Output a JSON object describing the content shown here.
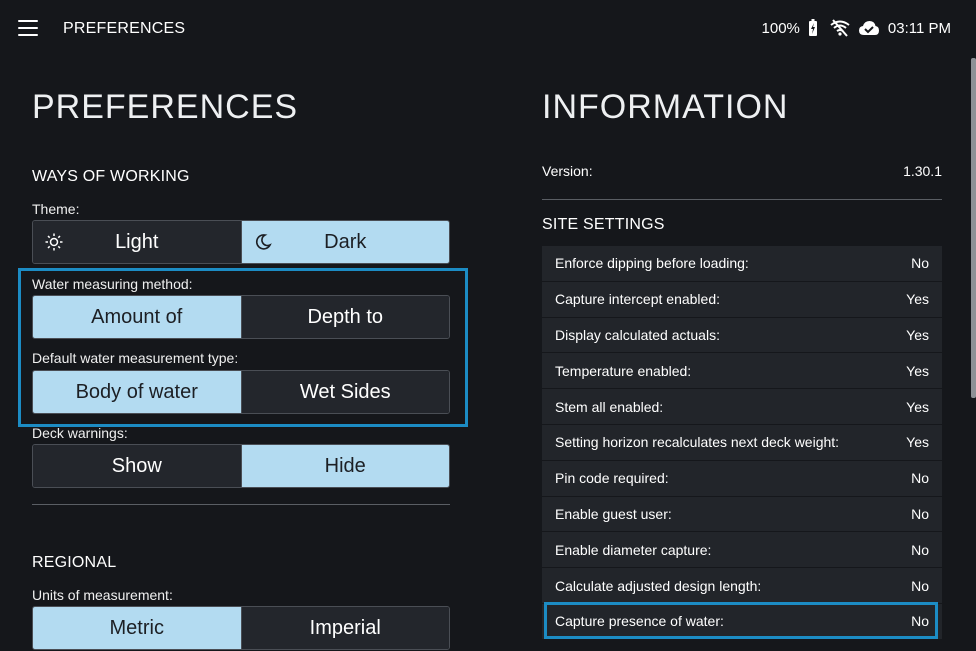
{
  "topbar": {
    "title": "PREFERENCES",
    "battery": "100%",
    "time": "03:11 PM"
  },
  "preferences": {
    "heading": "PREFERENCES",
    "ways_of_working": "WAYS OF WORKING",
    "theme": {
      "label": "Theme:",
      "options": [
        "Light",
        "Dark"
      ],
      "selected": "Dark"
    },
    "water_method": {
      "label": "Water measuring method:",
      "options": [
        "Amount of",
        "Depth to"
      ],
      "selected": "Amount of"
    },
    "water_type": {
      "label": "Default water measurement type:",
      "options": [
        "Body of water",
        "Wet Sides"
      ],
      "selected": "Body of water"
    },
    "deck_warnings": {
      "label": "Deck warnings:",
      "options": [
        "Show",
        "Hide"
      ],
      "selected": "Hide"
    },
    "regional": "REGIONAL",
    "units": {
      "label": "Units of measurement:",
      "options": [
        "Metric",
        "Imperial"
      ],
      "selected": "Metric"
    }
  },
  "information": {
    "heading": "INFORMATION",
    "version_label": "Version:",
    "version_value": "1.30.1",
    "site_settings": "SITE SETTINGS",
    "rows": [
      {
        "label": "Enforce dipping before loading:",
        "value": "No"
      },
      {
        "label": "Capture intercept enabled:",
        "value": "Yes"
      },
      {
        "label": "Display calculated actuals:",
        "value": "Yes"
      },
      {
        "label": "Temperature enabled:",
        "value": "Yes"
      },
      {
        "label": "Stem all enabled:",
        "value": "Yes"
      },
      {
        "label": "Setting horizon recalculates next deck weight:",
        "value": "Yes"
      },
      {
        "label": "Pin code required:",
        "value": "No"
      },
      {
        "label": "Enable guest user:",
        "value": "No"
      },
      {
        "label": "Enable diameter capture:",
        "value": "No"
      },
      {
        "label": "Calculate adjusted design length:",
        "value": "No"
      },
      {
        "label": "Capture presence of water:",
        "value": "No"
      }
    ]
  },
  "colors": {
    "selected": "#b3dbf1",
    "unselected": "#23262c",
    "highlight": "#1c8cc4",
    "background": "#15171b"
  }
}
